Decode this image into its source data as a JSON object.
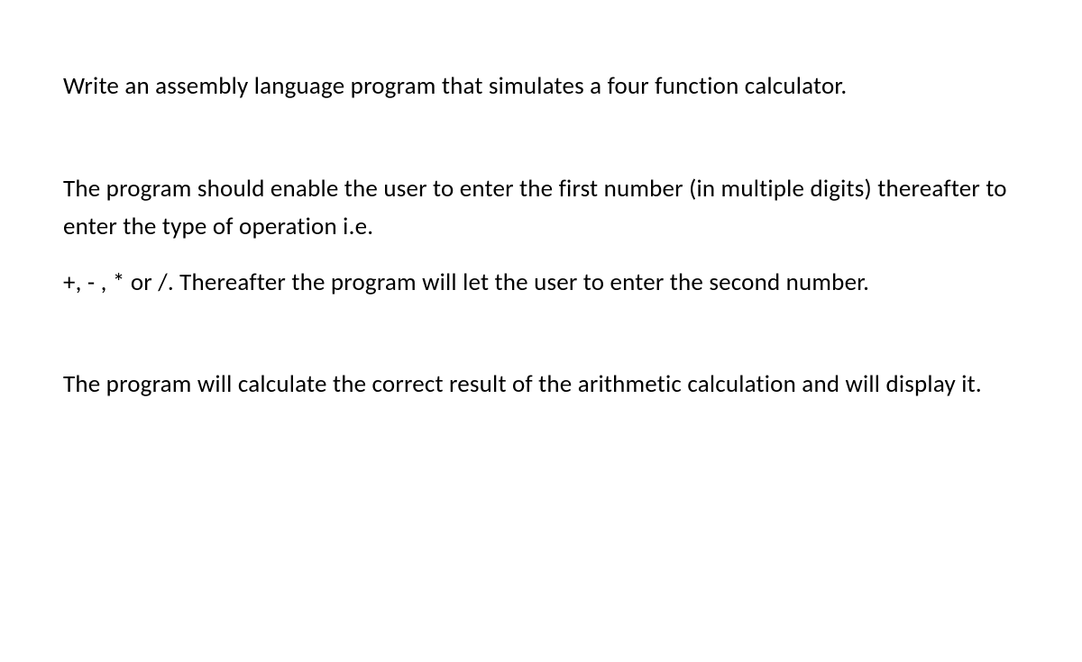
{
  "paragraphs": {
    "p1": "Write an assembly language program that simulates a four function calculator.",
    "p2a": "The program should enable the user to enter the first number (in multiple digits) thereafter to enter the type of operation i.e.",
    "p2b": "+, - , * or /. Thereafter the program will let the user to enter the second number.",
    "p3": "The program will calculate the correct result of the arithmetic calculation and will display it."
  }
}
